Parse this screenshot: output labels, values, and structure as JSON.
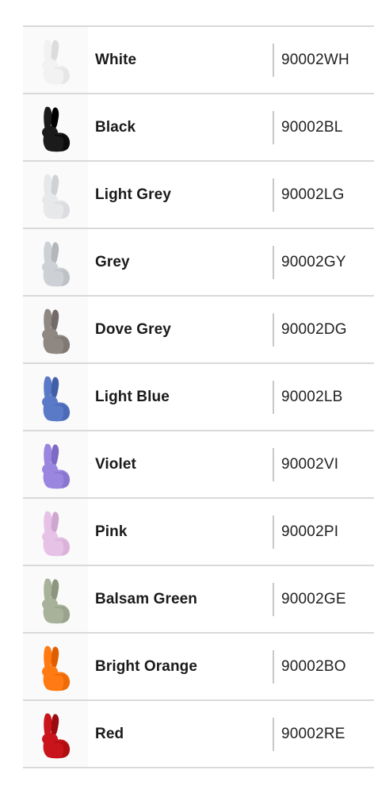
{
  "variants": [
    {
      "name": "White",
      "code": "90002WH",
      "color": "#f2f2f2",
      "shade": "#dcdcdc",
      "icon": "rabbit-chair-icon"
    },
    {
      "name": "Black",
      "code": "90002BL",
      "color": "#1b1b1b",
      "shade": "#000000",
      "icon": "rabbit-chair-icon"
    },
    {
      "name": "Light Grey",
      "code": "90002LG",
      "color": "#e6e8ea",
      "shade": "#cfd2d5",
      "icon": "rabbit-chair-icon"
    },
    {
      "name": "Grey",
      "code": "90002GY",
      "color": "#cdd0d4",
      "shade": "#b3b7bc",
      "icon": "rabbit-chair-icon"
    },
    {
      "name": "Dove Grey",
      "code": "90002DG",
      "color": "#8f8782",
      "shade": "#726b67",
      "icon": "rabbit-chair-icon"
    },
    {
      "name": "Light Blue",
      "code": "90002LB",
      "color": "#5a79c7",
      "shade": "#415fa9",
      "icon": "rabbit-chair-icon"
    },
    {
      "name": "Violet",
      "code": "90002VI",
      "color": "#9a85df",
      "shade": "#7e6ac4",
      "icon": "rabbit-chair-icon"
    },
    {
      "name": "Pink",
      "code": "90002PI",
      "color": "#e6c2e6",
      "shade": "#cfa6cf",
      "icon": "rabbit-chair-icon"
    },
    {
      "name": "Balsam Green",
      "code": "90002GE",
      "color": "#a8b29a",
      "shade": "#8d977f",
      "icon": "rabbit-chair-icon"
    },
    {
      "name": "Bright Orange",
      "code": "90002BO",
      "color": "#ff7a12",
      "shade": "#e05e00",
      "icon": "rabbit-chair-icon"
    },
    {
      "name": "Red",
      "code": "90002RE",
      "color": "#c8141a",
      "shade": "#9a0a0e",
      "icon": "rabbit-chair-icon"
    }
  ]
}
